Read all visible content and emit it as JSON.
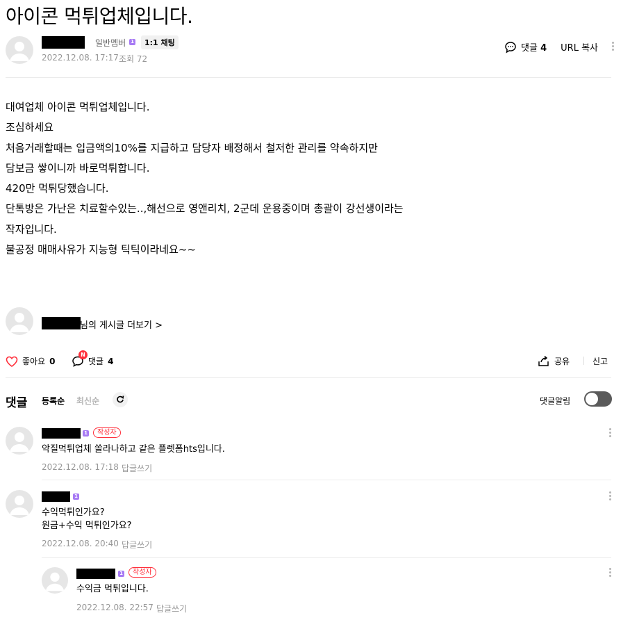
{
  "post": {
    "title": "아이콘 먹튀업체입니다.",
    "member_type": "일반멤버",
    "level_badge": "1",
    "chat_label": "1:1 채팅",
    "date": "2022.12.08. 17:17",
    "views": "조회 72",
    "comment_label": "댓글",
    "comment_count": "4",
    "url_copy": "URL 복사",
    "body_lines": [
      "대여업체 아이콘 먹튀업체입니다.",
      "조심하세요",
      "처음거래할때는 입금액의10%를 지급하고 담당자 배정해서 철저한 관리를 약속하지만",
      "담보금 쌓이니까 바로먹튀합니다.",
      "420만 먹튀당했습니다.",
      "단톡방은 가난은 치료할수있는..,해선으로 영앤리치, 2군데 운용중이며 총괄이 강선생이라는",
      "작자입니다.",
      "불공정 매매사유가 지능형 틱틱이라네요~~"
    ],
    "more_posts": "님의 게시글 더보기 >"
  },
  "actions": {
    "like_label": "좋아요",
    "like_count": "0",
    "comment_label": "댓글",
    "comment_count": "4",
    "new_badge": "N",
    "share": "공유",
    "report": "신고"
  },
  "comments_section": {
    "heading": "댓글",
    "sort_registered": "등록순",
    "sort_latest": "최신순",
    "notify": "댓글알림",
    "notify_on": false,
    "author_badge": "작성자",
    "reply_label": "답글쓰기",
    "comments": [
      {
        "lines": [
          "악질먹튀업체 쏠라나하고 같은 플렛폼hts입니다."
        ],
        "date": "2022.12.08. 17:18"
      },
      {
        "lines": [
          "수익먹튀인가요?",
          "원금+수익 먹튀인가요?"
        ],
        "date": "2022.12.08. 20:40"
      },
      {
        "lines": [
          "수익금 먹튀입니다."
        ],
        "date": "2022.12.08. 22:57"
      }
    ]
  },
  "colors": {
    "accent_red": "#ff2f3b",
    "badge_purple": "#a77af4",
    "text_gray": "#979797"
  }
}
